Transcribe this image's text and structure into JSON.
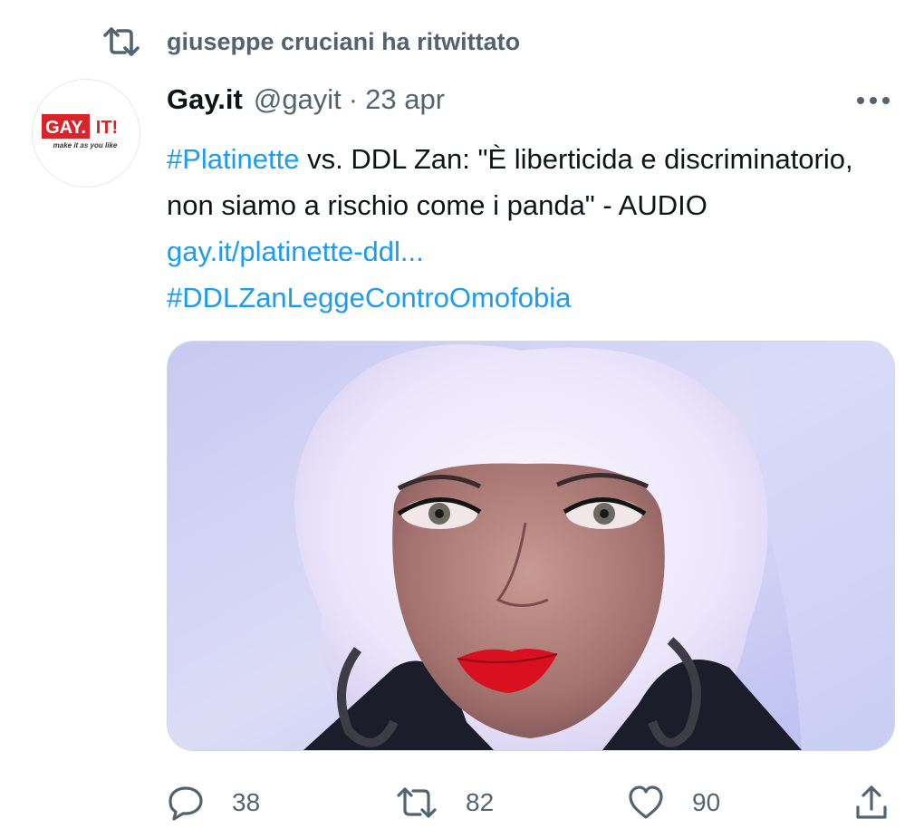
{
  "context": {
    "label": "giuseppe cruciani ha ritwittato",
    "icon": "retweet-icon"
  },
  "tweet": {
    "author": {
      "name": "Gay.it",
      "handle": "@gayit",
      "avatar_icon": "gay-it-logo",
      "logo_text": "GAY.",
      "logo_text_2": "IT!",
      "logo_tagline": "make it as you like"
    },
    "separator": "·",
    "date": "23 apr",
    "text": {
      "hashtag1": "#Platinette",
      "body": " vs. DDL Zan: \"È liberticida e discriminatorio, non siamo a rischio come i panda\" - AUDIO ",
      "link": "gay.it/platinette-ddl...",
      "hashtag2": "#DDLZanLeggeContro­Omofobia"
    },
    "media": {
      "type": "photo"
    },
    "actions": {
      "reply": {
        "icon": "reply-icon",
        "count": "38"
      },
      "retweet": {
        "icon": "retweet-icon",
        "count": "82"
      },
      "like": {
        "icon": "heart-icon",
        "count": "90"
      },
      "share": {
        "icon": "share-icon"
      }
    }
  },
  "colors": {
    "accent": "#1d9bf0",
    "secondary_text": "#536471",
    "logo_red": "#d6262c"
  }
}
